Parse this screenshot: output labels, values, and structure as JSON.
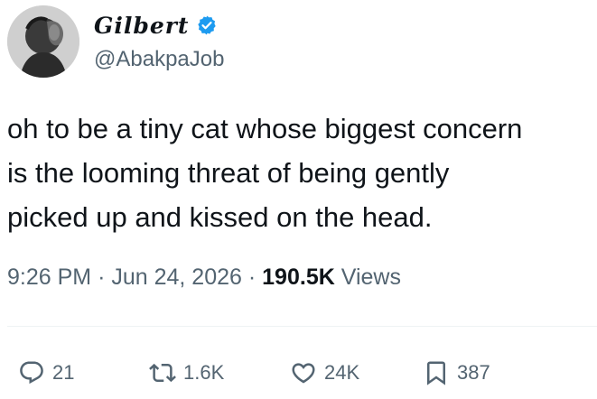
{
  "author": {
    "display_name": "Gilbert",
    "handle": "@AbakpaJob",
    "verified": true,
    "verified_color": "#1d9bf0"
  },
  "tweet": {
    "lines": [
      "oh to be a tiny cat whose biggest concern",
      "is the looming threat of being gently",
      "picked up and kissed on the head."
    ]
  },
  "meta": {
    "time": "9:26 PM",
    "separator": "·",
    "date": "Jun 24, 2026",
    "views_count": "190.5K",
    "views_label": "Views"
  },
  "actions": {
    "reply": {
      "icon": "reply-icon",
      "count": "21"
    },
    "retweet": {
      "icon": "retweet-icon",
      "count": "1.6K"
    },
    "like": {
      "icon": "heart-icon",
      "count": "24K"
    },
    "bookmark": {
      "icon": "bookmark-icon",
      "count": "387"
    }
  },
  "colors": {
    "text_primary": "#0f1419",
    "text_secondary": "#536471",
    "divider": "#eff3f4"
  }
}
